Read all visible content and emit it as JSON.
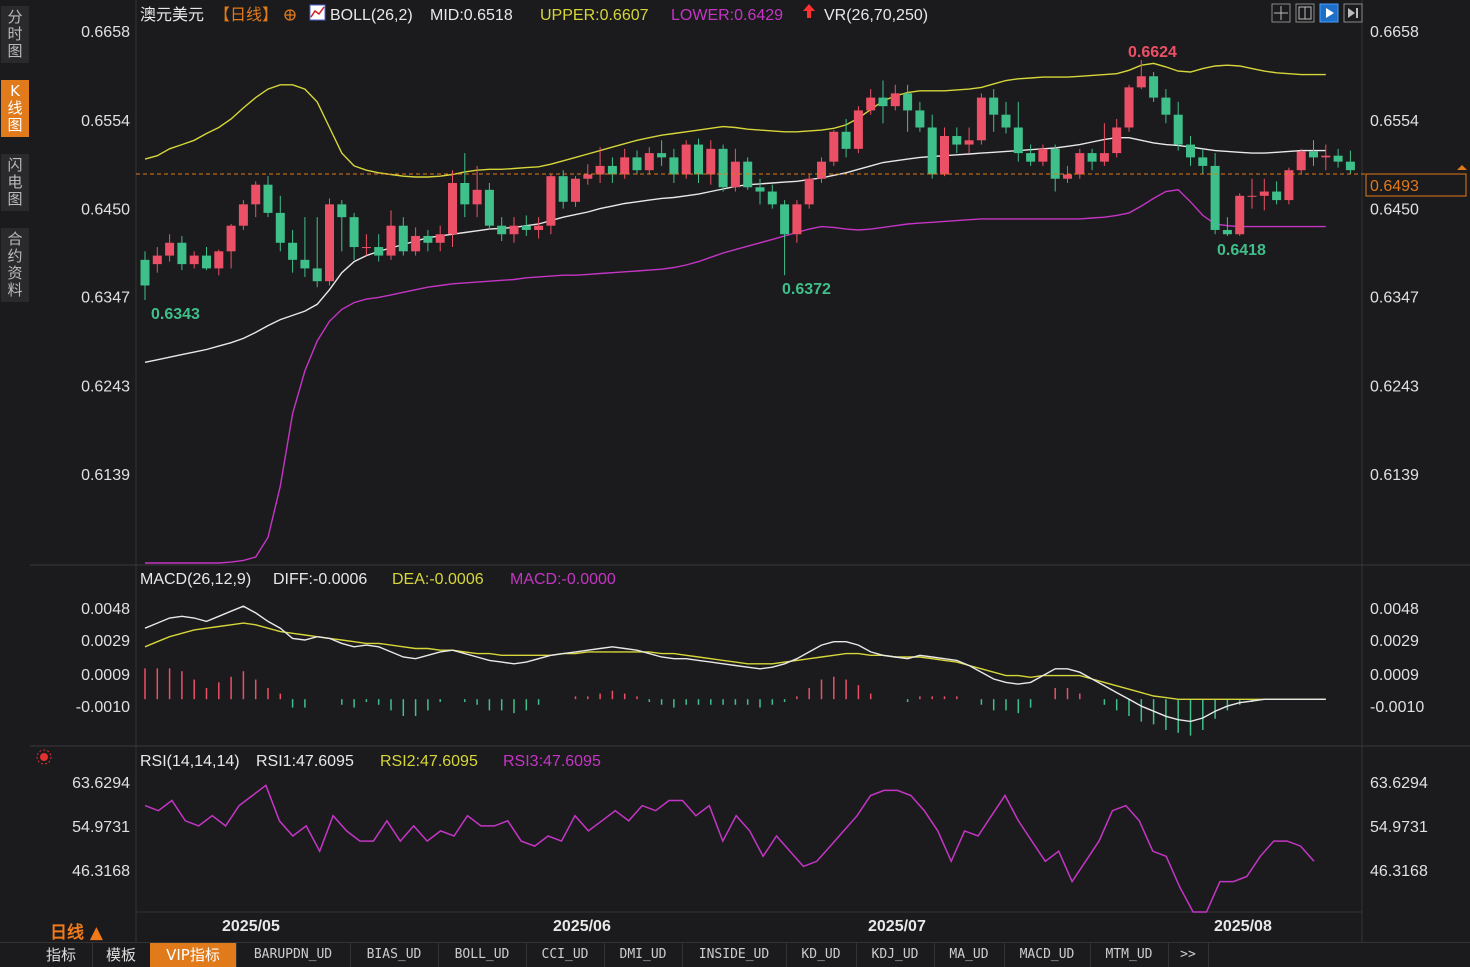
{
  "sidebar": {
    "tabs": [
      {
        "label": "分\n时\n图",
        "active": false
      },
      {
        "label": "K\n线\n图",
        "active": true
      },
      {
        "label": "闪\n电\n图",
        "active": false
      },
      {
        "label": "合\n约\n资\n料",
        "active": false
      }
    ]
  },
  "header": {
    "symbol": "澳元美元",
    "period_tag": "【日线】",
    "indicator_name": "BOLL(26,2)",
    "mid": "MID:0.6518",
    "upper": "UPPER:0.6607",
    "lower": "LOWER:0.6429",
    "vr": "VR(26,70,250)"
  },
  "toolbar_icons": [
    "crosshair-icon",
    "grid-icon",
    "play-icon",
    "jump-end-icon"
  ],
  "price_axis": {
    "ticks": [
      "0.6658",
      "0.6554",
      "0.6450",
      "0.6347",
      "0.6243",
      "0.6139"
    ],
    "current_price": "0.6493"
  },
  "annotations": {
    "high": "0.6624",
    "low1": "0.6343",
    "low2": "0.6372",
    "low3": "0.6418"
  },
  "macd": {
    "title": "MACD(26,12,9)",
    "diff": "DIFF:-0.0006",
    "dea": "DEA:-0.0006",
    "macd": "MACD:-0.0000",
    "ticks": [
      "0.0048",
      "0.0029",
      "0.0009",
      "-0.0010"
    ]
  },
  "rsi": {
    "title": "RSI(14,14,14)",
    "rsi1": "RSI1:47.6095",
    "rsi2": "RSI2:47.6095",
    "rsi3": "RSI3:47.6095",
    "ticks": [
      "63.6294",
      "54.9731",
      "46.3168"
    ]
  },
  "time_axis": [
    "2025/05",
    "2025/06",
    "2025/07",
    "2025/08"
  ],
  "period_label": "日线 ▲",
  "bottom_tabs": [
    {
      "label": "指标",
      "active": false,
      "ind": false
    },
    {
      "label": "模板",
      "active": false,
      "ind": false
    },
    {
      "label": "VIP指标",
      "active": true,
      "ind": false
    },
    {
      "label": "BARUPDN_UD",
      "active": false,
      "ind": true
    },
    {
      "label": "BIAS_UD",
      "active": false,
      "ind": true
    },
    {
      "label": "BOLL_UD",
      "active": false,
      "ind": true
    },
    {
      "label": "CCI_UD",
      "active": false,
      "ind": true
    },
    {
      "label": "DMI_UD",
      "active": false,
      "ind": true
    },
    {
      "label": "INSIDE_UD",
      "active": false,
      "ind": true
    },
    {
      "label": "KD_UD",
      "active": false,
      "ind": true
    },
    {
      "label": "KDJ_UD",
      "active": false,
      "ind": true
    },
    {
      "label": "MA_UD",
      "active": false,
      "ind": true
    },
    {
      "label": "MACD_UD",
      "active": false,
      "ind": true
    },
    {
      "label": "MTM_UD",
      "active": false,
      "ind": true
    },
    {
      "label": ">>",
      "active": false,
      "ind": true
    }
  ],
  "colors": {
    "up": "#ec5066",
    "down": "#3fbf8a",
    "upper": "#d6d63a",
    "lower": "#c535c5",
    "mid": "#e8e8e8",
    "accent": "#e07a1a",
    "high_label": "#ec5066",
    "low_label": "#3fbf8a"
  },
  "chart_data": {
    "type": "candlestick",
    "price_range": [
      0.6035,
      0.6658
    ],
    "candles": [
      [
        0.639,
        0.636,
        0.64,
        0.6343
      ],
      [
        0.6385,
        0.6395,
        0.6405,
        0.6375
      ],
      [
        0.6395,
        0.641,
        0.642,
        0.6388
      ],
      [
        0.641,
        0.6385,
        0.6418,
        0.6378
      ],
      [
        0.6385,
        0.6395,
        0.64,
        0.638
      ],
      [
        0.6395,
        0.638,
        0.6405,
        0.6378
      ],
      [
        0.638,
        0.64,
        0.6402,
        0.6372
      ],
      [
        0.64,
        0.643,
        0.6432,
        0.638
      ],
      [
        0.643,
        0.6455,
        0.646,
        0.6425
      ],
      [
        0.6455,
        0.6478,
        0.6482,
        0.644
      ],
      [
        0.6478,
        0.6445,
        0.6488,
        0.644
      ],
      [
        0.6445,
        0.641,
        0.6465,
        0.64
      ],
      [
        0.641,
        0.639,
        0.6425,
        0.6375
      ],
      [
        0.639,
        0.638,
        0.644,
        0.637
      ],
      [
        0.638,
        0.6365,
        0.644,
        0.6358
      ],
      [
        0.6365,
        0.6455,
        0.6462,
        0.636
      ],
      [
        0.6455,
        0.644,
        0.646,
        0.64
      ],
      [
        0.644,
        0.6405,
        0.6445,
        0.639
      ],
      [
        0.6405,
        0.6405,
        0.642,
        0.6395
      ],
      [
        0.6405,
        0.6395,
        0.642,
        0.6388
      ],
      [
        0.6395,
        0.643,
        0.6448,
        0.639
      ],
      [
        0.643,
        0.64,
        0.644,
        0.6395
      ],
      [
        0.64,
        0.6418,
        0.6428,
        0.6395
      ],
      [
        0.6418,
        0.641,
        0.6425,
        0.64
      ],
      [
        0.641,
        0.642,
        0.643,
        0.64
      ],
      [
        0.642,
        0.648,
        0.6495,
        0.6405
      ],
      [
        0.648,
        0.6455,
        0.6515,
        0.644
      ],
      [
        0.6455,
        0.6472,
        0.65,
        0.644
      ],
      [
        0.6472,
        0.643,
        0.648,
        0.6425
      ],
      [
        0.643,
        0.642,
        0.644,
        0.6412
      ],
      [
        0.642,
        0.643,
        0.644,
        0.641
      ],
      [
        0.643,
        0.6425,
        0.6442,
        0.6418
      ],
      [
        0.6425,
        0.643,
        0.644,
        0.6415
      ],
      [
        0.643,
        0.6488,
        0.649,
        0.642
      ],
      [
        0.6488,
        0.6458,
        0.6495,
        0.645
      ],
      [
        0.6458,
        0.6485,
        0.6488,
        0.6452
      ],
      [
        0.6485,
        0.649,
        0.6502,
        0.6478
      ],
      [
        0.649,
        0.65,
        0.6522,
        0.648
      ],
      [
        0.65,
        0.649,
        0.651,
        0.648
      ],
      [
        0.649,
        0.651,
        0.652,
        0.6485
      ],
      [
        0.651,
        0.6495,
        0.6518,
        0.649
      ],
      [
        0.6495,
        0.6515,
        0.6522,
        0.649
      ],
      [
        0.6515,
        0.651,
        0.653,
        0.65
      ],
      [
        0.651,
        0.649,
        0.652,
        0.648
      ],
      [
        0.649,
        0.6525,
        0.653,
        0.6485
      ],
      [
        0.6525,
        0.649,
        0.6532,
        0.648
      ],
      [
        0.649,
        0.652,
        0.653,
        0.6478
      ],
      [
        0.652,
        0.6475,
        0.6525,
        0.647
      ],
      [
        0.6475,
        0.6505,
        0.652,
        0.647
      ],
      [
        0.6505,
        0.6475,
        0.651,
        0.6472
      ],
      [
        0.6475,
        0.647,
        0.6485,
        0.6455
      ],
      [
        0.647,
        0.6455,
        0.6478,
        0.645
      ],
      [
        0.6455,
        0.642,
        0.646,
        0.6372
      ],
      [
        0.642,
        0.6455,
        0.646,
        0.641
      ],
      [
        0.6455,
        0.6485,
        0.649,
        0.645
      ],
      [
        0.6485,
        0.6505,
        0.651,
        0.648
      ],
      [
        0.6505,
        0.654,
        0.6542,
        0.65
      ],
      [
        0.654,
        0.652,
        0.6555,
        0.651
      ],
      [
        0.652,
        0.6565,
        0.657,
        0.6515
      ],
      [
        0.6565,
        0.658,
        0.659,
        0.656
      ],
      [
        0.658,
        0.657,
        0.66,
        0.655
      ],
      [
        0.657,
        0.6585,
        0.6595,
        0.6565
      ],
      [
        0.6585,
        0.6565,
        0.6595,
        0.654
      ],
      [
        0.6565,
        0.6545,
        0.6575,
        0.654
      ],
      [
        0.6545,
        0.649,
        0.656,
        0.6485
      ],
      [
        0.649,
        0.6535,
        0.6545,
        0.6488
      ],
      [
        0.6535,
        0.6525,
        0.6545,
        0.6515
      ],
      [
        0.6525,
        0.653,
        0.6545,
        0.6515
      ],
      [
        0.653,
        0.658,
        0.6585,
        0.6525
      ],
      [
        0.658,
        0.656,
        0.659,
        0.654
      ],
      [
        0.656,
        0.6545,
        0.6575,
        0.6538
      ],
      [
        0.6545,
        0.6515,
        0.6575,
        0.6505
      ],
      [
        0.6515,
        0.6505,
        0.6525,
        0.65
      ],
      [
        0.6505,
        0.652,
        0.6525,
        0.65
      ],
      [
        0.652,
        0.6485,
        0.6525,
        0.647
      ],
      [
        0.6485,
        0.649,
        0.65,
        0.648
      ],
      [
        0.649,
        0.6515,
        0.652,
        0.6485
      ],
      [
        0.6515,
        0.6505,
        0.652,
        0.6495
      ],
      [
        0.6505,
        0.6515,
        0.655,
        0.65
      ],
      [
        0.6515,
        0.6545,
        0.6555,
        0.651
      ],
      [
        0.6545,
        0.6592,
        0.6595,
        0.654
      ],
      [
        0.6592,
        0.6605,
        0.6624,
        0.659
      ],
      [
        0.6605,
        0.658,
        0.661,
        0.6575
      ],
      [
        0.658,
        0.656,
        0.659,
        0.655
      ],
      [
        0.656,
        0.6525,
        0.6575,
        0.6518
      ],
      [
        0.6525,
        0.651,
        0.6535,
        0.65
      ],
      [
        0.651,
        0.65,
        0.652,
        0.649
      ],
      [
        0.65,
        0.6425,
        0.6515,
        0.642
      ],
      [
        0.6425,
        0.642,
        0.644,
        0.6418
      ],
      [
        0.642,
        0.6465,
        0.6468,
        0.6418
      ],
      [
        0.6465,
        0.6465,
        0.6485,
        0.645
      ],
      [
        0.6465,
        0.647,
        0.6485,
        0.6448
      ],
      [
        0.647,
        0.646,
        0.6482,
        0.6455
      ],
      [
        0.646,
        0.6495,
        0.6498,
        0.6455
      ],
      [
        0.6495,
        0.6517,
        0.652,
        0.649
      ],
      [
        0.6517,
        0.651,
        0.653,
        0.65
      ],
      [
        0.651,
        0.6512,
        0.6525,
        0.6495
      ],
      [
        0.6512,
        0.6505,
        0.652,
        0.6498
      ],
      [
        0.6505,
        0.6495,
        0.6518,
        0.649
      ]
    ],
    "boll_upper": [
      0.6508,
      0.6512,
      0.652,
      0.6525,
      0.653,
      0.6538,
      0.6545,
      0.6555,
      0.6568,
      0.658,
      0.659,
      0.6595,
      0.6595,
      0.659,
      0.6575,
      0.6545,
      0.6515,
      0.65,
      0.6495,
      0.6492,
      0.649,
      0.6488,
      0.6487,
      0.6487,
      0.6488,
      0.649,
      0.6493,
      0.6495,
      0.6496,
      0.6496,
      0.6497,
      0.6498,
      0.6499,
      0.6502,
      0.6506,
      0.651,
      0.6514,
      0.6518,
      0.6522,
      0.6526,
      0.653,
      0.6533,
      0.6536,
      0.6538,
      0.654,
      0.6542,
      0.6544,
      0.6546,
      0.6545,
      0.6543,
      0.6542,
      0.6541,
      0.654,
      0.654,
      0.6541,
      0.6542,
      0.6544,
      0.6548,
      0.6556,
      0.6566,
      0.6576,
      0.6582,
      0.6586,
      0.6588,
      0.6588,
      0.6588,
      0.6589,
      0.659,
      0.6592,
      0.6596,
      0.66,
      0.6602,
      0.6603,
      0.6604,
      0.6604,
      0.6604,
      0.6605,
      0.6606,
      0.6607,
      0.6608,
      0.6612,
      0.6618,
      0.662,
      0.6616,
      0.6611,
      0.661,
      0.6614,
      0.6617,
      0.6618,
      0.6617,
      0.6614,
      0.6611,
      0.6609,
      0.6608,
      0.6607,
      0.6607,
      0.6607
    ],
    "boll_mid": [
      0.627,
      0.6273,
      0.6276,
      0.6279,
      0.6282,
      0.6285,
      0.6289,
      0.6293,
      0.6298,
      0.6305,
      0.6313,
      0.632,
      0.6325,
      0.633,
      0.6338,
      0.6355,
      0.6375,
      0.6388,
      0.6395,
      0.64,
      0.6404,
      0.6408,
      0.6412,
      0.6416,
      0.6418,
      0.642,
      0.6422,
      0.6424,
      0.6426,
      0.6427,
      0.6428,
      0.643,
      0.6432,
      0.6436,
      0.644,
      0.6443,
      0.6446,
      0.645,
      0.6453,
      0.6456,
      0.6458,
      0.646,
      0.6462,
      0.6463,
      0.6465,
      0.6467,
      0.647,
      0.6473,
      0.6476,
      0.6478,
      0.6479,
      0.648,
      0.6481,
      0.6482,
      0.6484,
      0.6486,
      0.6489,
      0.6492,
      0.6496,
      0.65,
      0.6504,
      0.6506,
      0.6508,
      0.651,
      0.6511,
      0.6512,
      0.6513,
      0.6514,
      0.6515,
      0.6516,
      0.6517,
      0.6518,
      0.6519,
      0.652,
      0.6521,
      0.6523,
      0.6525,
      0.6528,
      0.6531,
      0.6533,
      0.6533,
      0.653,
      0.6527,
      0.6525,
      0.6524,
      0.6522,
      0.652,
      0.6518,
      0.6517,
      0.6516,
      0.6515,
      0.6515,
      0.6516,
      0.6517,
      0.6518,
      0.6518,
      0.6518
    ],
    "boll_lower": [
      0.6035,
      0.6035,
      0.6035,
      0.6035,
      0.6035,
      0.6035,
      0.6035,
      0.6036,
      0.6038,
      0.6042,
      0.6065,
      0.6125,
      0.621,
      0.626,
      0.6295,
      0.6318,
      0.6332,
      0.634,
      0.6344,
      0.6346,
      0.6349,
      0.6352,
      0.6355,
      0.6358,
      0.636,
      0.6362,
      0.6363,
      0.6364,
      0.6365,
      0.6366,
      0.6367,
      0.6369,
      0.637,
      0.6371,
      0.6372,
      0.6372,
      0.6373,
      0.6374,
      0.6375,
      0.6376,
      0.6377,
      0.6378,
      0.6379,
      0.6381,
      0.6384,
      0.6388,
      0.6393,
      0.6398,
      0.6402,
      0.6406,
      0.641,
      0.6414,
      0.6418,
      0.6422,
      0.6426,
      0.6429,
      0.6428,
      0.6426,
      0.6425,
      0.6426,
      0.6428,
      0.643,
      0.6432,
      0.6433,
      0.6434,
      0.6435,
      0.6436,
      0.6437,
      0.6438,
      0.6438,
      0.6438,
      0.6438,
      0.6438,
      0.6438,
      0.6438,
      0.6438,
      0.6438,
      0.6439,
      0.644,
      0.6442,
      0.6445,
      0.6453,
      0.6462,
      0.647,
      0.6472,
      0.6458,
      0.6442,
      0.6432,
      0.643,
      0.6429,
      0.6429,
      0.6429,
      0.6429,
      0.6429,
      0.6429,
      0.6429,
      0.6429
    ],
    "macd_range": [
      -0.003,
      0.0055
    ],
    "macd_diff": [
      0.0036,
      0.0039,
      0.0042,
      0.0043,
      0.0042,
      0.004,
      0.0043,
      0.0046,
      0.0049,
      0.0045,
      0.004,
      0.0036,
      0.003,
      0.0029,
      0.0031,
      0.003,
      0.0027,
      0.0025,
      0.0026,
      0.0025,
      0.0022,
      0.0019,
      0.0018,
      0.002,
      0.0022,
      0.0023,
      0.0021,
      0.0019,
      0.0017,
      0.0016,
      0.0015,
      0.0016,
      0.0018,
      0.002,
      0.0021,
      0.0022,
      0.0023,
      0.0024,
      0.0025,
      0.0024,
      0.0023,
      0.0021,
      0.0019,
      0.0018,
      0.0018,
      0.0017,
      0.0016,
      0.0015,
      0.0014,
      0.0013,
      0.0012,
      0.0013,
      0.0015,
      0.0018,
      0.0022,
      0.0026,
      0.0028,
      0.0028,
      0.0026,
      0.0022,
      0.002,
      0.0019,
      0.0018,
      0.002,
      0.0019,
      0.0018,
      0.0017,
      0.0014,
      0.001,
      0.0006,
      0.0004,
      0.0003,
      0.0004,
      0.0008,
      0.0012,
      0.0012,
      0.001,
      0.0006,
      0.0002,
      -0.0002,
      -0.0006,
      -0.001,
      -0.0013,
      -0.0016,
      -0.0018,
      -0.0019,
      -0.0017,
      -0.0013,
      -0.001,
      -0.0008,
      -0.0007,
      -0.0006,
      -0.0006,
      -0.0006,
      -0.0006,
      -0.0006,
      -0.0006
    ],
    "macd_dea": [
      0.0025,
      0.0028,
      0.0031,
      0.0033,
      0.0035,
      0.0036,
      0.0037,
      0.0038,
      0.0039,
      0.0038,
      0.0036,
      0.0034,
      0.0033,
      0.0032,
      0.0031,
      0.003,
      0.0029,
      0.0028,
      0.0027,
      0.0027,
      0.0026,
      0.0025,
      0.0024,
      0.0024,
      0.0023,
      0.0023,
      0.0022,
      0.0021,
      0.0021,
      0.002,
      0.002,
      0.002,
      0.002,
      0.002,
      0.0021,
      0.0021,
      0.0022,
      0.0022,
      0.0022,
      0.0022,
      0.0022,
      0.0022,
      0.0021,
      0.0021,
      0.002,
      0.0019,
      0.0018,
      0.0017,
      0.0016,
      0.0015,
      0.0015,
      0.0015,
      0.0016,
      0.0017,
      0.0018,
      0.0019,
      0.002,
      0.0021,
      0.0021,
      0.002,
      0.002,
      0.0019,
      0.0019,
      0.0019,
      0.0018,
      0.0017,
      0.0016,
      0.0014,
      0.0012,
      0.001,
      0.0008,
      0.0008,
      0.0007,
      0.0008,
      0.0008,
      0.0008,
      0.0008,
      0.0006,
      0.0004,
      0.0002,
      0.0,
      -0.0002,
      -0.0004,
      -0.0005,
      -0.0006,
      -0.0006,
      -0.0006,
      -0.0006,
      -0.0006,
      -0.0006,
      -0.0006,
      -0.0006,
      -0.0006,
      -0.0006,
      -0.0006,
      -0.0006,
      -0.0006
    ],
    "rsi_range": [
      38,
      68
    ],
    "rsi": [
      59,
      58,
      60,
      56,
      55,
      57,
      55,
      59,
      61,
      63,
      56,
      53,
      55,
      50,
      57,
      54,
      52,
      52,
      56,
      52,
      55,
      52,
      54,
      53,
      57,
      55,
      55,
      56,
      52,
      51,
      53,
      52,
      57,
      54,
      56,
      58,
      56,
      59,
      58,
      60,
      60,
      57,
      59,
      52,
      57,
      54,
      49,
      53,
      50,
      47,
      48,
      51,
      54,
      57,
      61,
      62,
      62,
      61,
      58,
      54,
      48,
      54,
      53,
      57,
      61,
      56,
      52,
      48,
      50,
      44,
      48,
      52,
      58,
      59,
      56,
      50,
      49,
      43,
      38,
      38,
      44,
      44,
      45,
      49,
      52,
      52,
      51,
      48
    ]
  }
}
